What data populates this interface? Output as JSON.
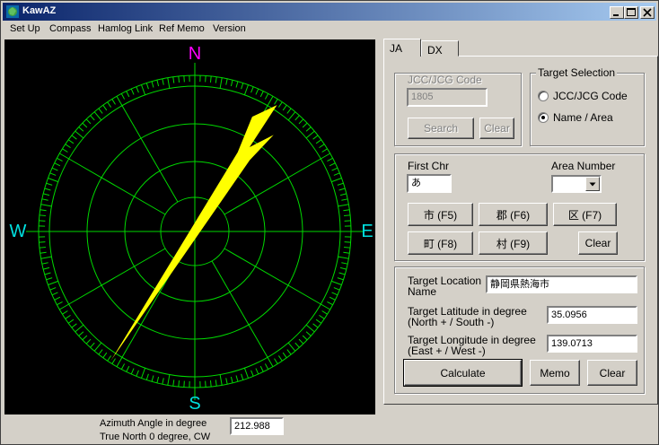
{
  "window": {
    "title": "KawAZ"
  },
  "menu": [
    "Set Up",
    "Compass",
    "Hamlog Link",
    "Ref Memo",
    "Version"
  ],
  "compass": {
    "north": "N",
    "east": "E",
    "south": "S",
    "west": "W",
    "azimuth": 212.988,
    "colors": {
      "background": "#000000",
      "grid": "#00d800",
      "pointer": "#ffff00",
      "north_label": "#ff00ff",
      "other_labels": "#00e0e0"
    }
  },
  "azimuth_panel": {
    "label_line1": "Azimuth Angle in degree",
    "label_line2": "True North 0 degree, CW",
    "value": "212.988"
  },
  "tabs": {
    "ja": "JA",
    "dx": "DX"
  },
  "jcc": {
    "legend": "JCC/JCG Code",
    "value": "1805",
    "search": "Search",
    "clear": "Clear"
  },
  "target_selection": {
    "legend": "Target Selection",
    "option1": "JCC/JCG Code",
    "option2": "Name / Area",
    "selected": 2
  },
  "chars": {
    "first_chr_label": "First Chr",
    "first_chr_value": "あ",
    "area_number_label": "Area Number",
    "area_number_value": "",
    "btn_city": "市 (F5)",
    "btn_county": "郡 (F6)",
    "btn_ward": "区 (F7)",
    "btn_town": "町 (F8)",
    "btn_village": "村 (F9)",
    "btn_clear": "Clear"
  },
  "target": {
    "location_label_1": "Target Location",
    "location_label_2": "Name",
    "location_value": "静岡県熱海市",
    "lat_label_1": "Target Latitude in degree",
    "lat_label_2": "(North + / South -)",
    "lat_value": "35.0956",
    "lon_label_1": "Target Longitude in degree",
    "lon_label_2": "(East + / West -)",
    "lon_value": "139.0713",
    "calculate": "Calculate",
    "memo": "Memo",
    "clear": "Clear"
  }
}
